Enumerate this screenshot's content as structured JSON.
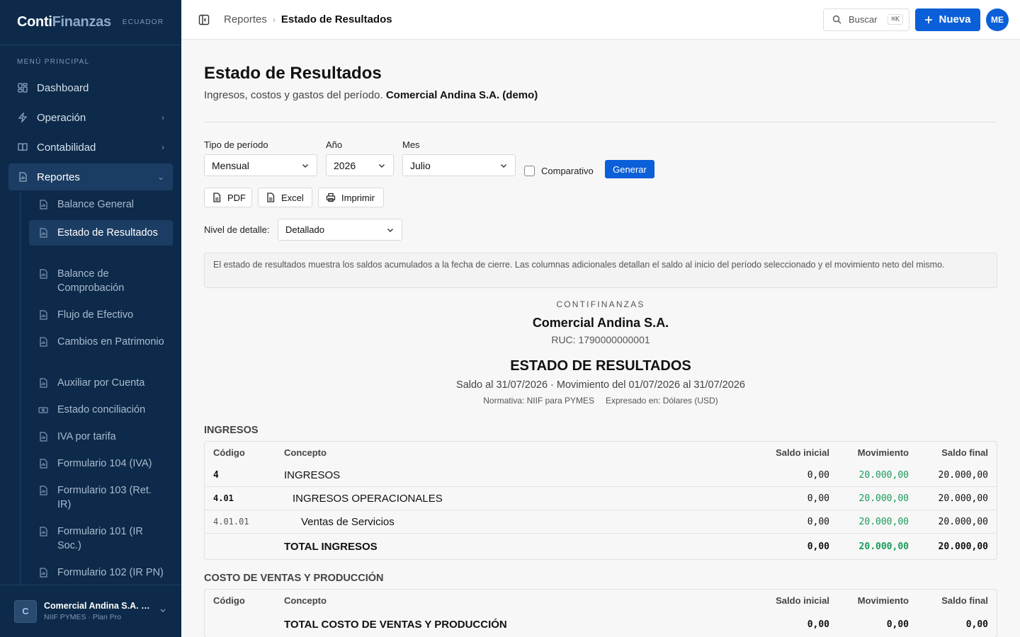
{
  "brand": {
    "name_bold": "Conti",
    "name_light": "Finanzas",
    "country": "ECUADOR"
  },
  "sidebar": {
    "menu_heading": "MENÚ PRINCIPAL",
    "items": [
      {
        "label": "Dashboard",
        "icon": "dashboard-icon"
      },
      {
        "label": "Operación",
        "icon": "bolt-icon"
      },
      {
        "label": "Contabilidad",
        "icon": "book-icon"
      },
      {
        "label": "Reportes",
        "icon": "report-icon"
      }
    ],
    "report_items": [
      {
        "label": "Balance General"
      },
      {
        "label": "Estado de Resultados"
      },
      {
        "label": "Balance de Comprobación"
      },
      {
        "label": "Flujo de Efectivo"
      },
      {
        "label": "Cambios en Patrimonio"
      },
      {
        "label": "Auxiliar por Cuenta"
      },
      {
        "label": "Estado conciliación"
      },
      {
        "label": "IVA por tarifa"
      },
      {
        "label": "Formulario 104 (IVA)"
      },
      {
        "label": "Formulario 103 (Ret. IR)"
      },
      {
        "label": "Formulario 101 (IR Soc.)"
      },
      {
        "label": "Formulario 102 (IR PN)"
      }
    ],
    "org": {
      "initial": "C",
      "name": "Comercial Andina S.A. (demo)",
      "plan": "NIIF PYMES · Plan Pro"
    }
  },
  "topbar": {
    "breadcrumb_parent": "Reportes",
    "breadcrumb_current": "Estado de Resultados",
    "search_label": "Buscar",
    "search_shortcut": "⌘K",
    "new_label": "Nueva",
    "avatar_initials": "ME"
  },
  "page": {
    "title": "Estado de Resultados",
    "subtitle": "Ingresos, costos y gastos del período.",
    "company": "Comercial Andina S.A. (demo)"
  },
  "filters": {
    "period_type_label": "Tipo de período",
    "period_type_value": "Mensual",
    "year_label": "Año",
    "year_value": "2026",
    "month_label": "Mes",
    "month_value": "Julio",
    "comparative_label": "Comparativo",
    "generate_label": "Generar",
    "detail_label": "Nivel de detalle:",
    "detail_value": "Detallado"
  },
  "actions": {
    "pdf": "PDF",
    "excel": "Excel",
    "print": "Imprimir"
  },
  "note": "El estado de resultados muestra los saldos acumulados a la fecha de cierre. Las columnas adicionales detallan el saldo al inicio del período seleccionado y el movimiento neto del mismo.",
  "report": {
    "brand": "CONTIFINANZAS",
    "company": "Comercial Andina S.A.",
    "ruc": "RUC: 1790000000001",
    "title": "ESTADO DE RESULTADOS",
    "period": "Saldo al 31/07/2026 · Movimiento del 01/07/2026 al 31/07/2026",
    "norm": "Normativa: NIIF para PYMES",
    "currency": "Expresado en: Dólares (USD)",
    "columns": {
      "code": "Código",
      "concept": "Concepto",
      "initial": "Saldo inicial",
      "movement": "Movimiento",
      "final": "Saldo final"
    },
    "sections": [
      {
        "title": "INGRESOS",
        "rows": [
          {
            "code": "4",
            "concept": "INGRESOS",
            "initial": "0,00",
            "movement": "20.000,00",
            "final": "20.000,00"
          },
          {
            "code": "4.01",
            "concept": "INGRESOS OPERACIONALES",
            "initial": "0,00",
            "movement": "20.000,00",
            "final": "20.000,00"
          },
          {
            "code": "4.01.01",
            "concept": "Ventas de Servicios",
            "initial": "0,00",
            "movement": "20.000,00",
            "final": "20.000,00"
          }
        ],
        "total": {
          "concept": "TOTAL INGRESOS",
          "initial": "0,00",
          "movement": "20.000,00",
          "final": "20.000,00"
        }
      },
      {
        "title": "COSTO DE VENTAS Y PRODUCCIÓN",
        "rows": [],
        "total": {
          "concept": "TOTAL COSTO DE VENTAS Y PRODUCCIÓN",
          "initial": "0,00",
          "movement": "0,00",
          "final": "0,00"
        }
      }
    ]
  },
  "colors": {
    "sidebar": "#0d2a4a",
    "accent": "#0b5fd8",
    "positive": "#1a9a5a"
  }
}
